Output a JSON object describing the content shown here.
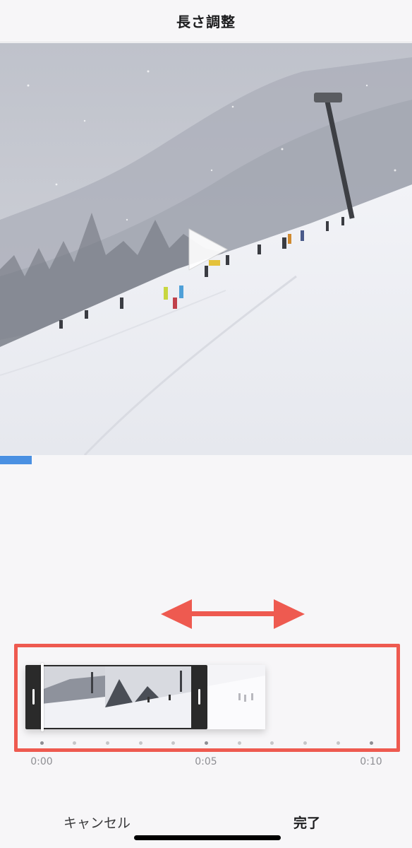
{
  "header": {
    "title": "長さ調整"
  },
  "video": {
    "play_icon": "play-icon",
    "progress_fraction": 0.077
  },
  "trim": {
    "selection_start_seconds": 0,
    "selection_end_seconds": 5,
    "total_seconds": 10,
    "timeline_labels": [
      "0:00",
      "0:05",
      "0:10"
    ],
    "highlight_color": "#ee5a50"
  },
  "footer": {
    "cancel_label": "キャンセル",
    "done_label": "完了"
  },
  "colors": {
    "progress": "#4a90e2",
    "annotation": "#ee5a50",
    "handle": "#2a2a2a"
  }
}
